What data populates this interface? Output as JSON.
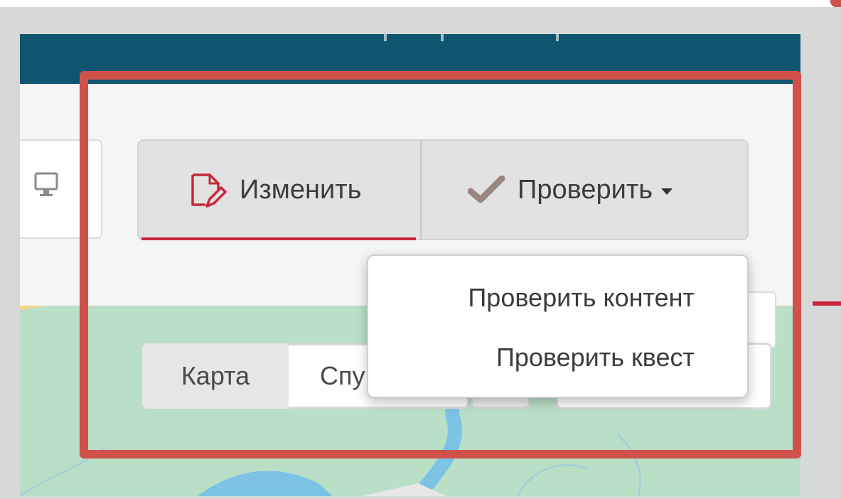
{
  "toolbar": {
    "edit_label": "Изменить",
    "verify_label": "Проверить"
  },
  "verify_menu": {
    "items": [
      "Проверить контент",
      "Проверить квест"
    ]
  },
  "map_type": {
    "map_label": "Карта",
    "satellite_label_partial": "Спу"
  },
  "icons": {
    "edit": "edit-document-icon",
    "verify": "checkmark-icon",
    "device": "monitor-icon"
  },
  "colors": {
    "header": "#0f5570",
    "highlight_frame": "#d0504a",
    "active_underline": "#c8283b",
    "map_background": "#b9dfc7"
  }
}
